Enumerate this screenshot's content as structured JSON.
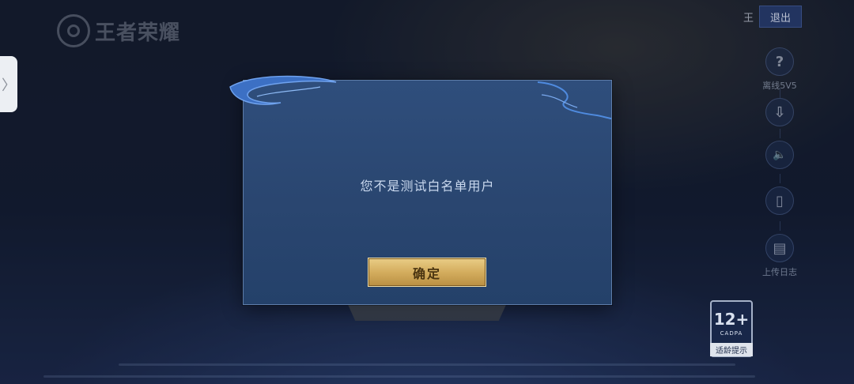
{
  "app": {
    "logo_text": "王者荣耀"
  },
  "side_tab": {
    "icon": "chevron-right-icon",
    "glyph": "〉"
  },
  "header": {
    "user_name": "王",
    "logout_label": "退出"
  },
  "right_menu": [
    {
      "id": "offline",
      "icon": "question-icon",
      "glyph": "?",
      "label": "离线5V5"
    },
    {
      "id": "download",
      "icon": "download-icon",
      "glyph": "⇩",
      "label": ""
    },
    {
      "id": "sound",
      "icon": "speaker-icon",
      "glyph": "🔈",
      "label": ""
    },
    {
      "id": "repair",
      "icon": "phone-repair-icon",
      "glyph": "▯",
      "label": ""
    },
    {
      "id": "upload-log",
      "icon": "clipboard-icon",
      "glyph": "▤",
      "label": "上传日志"
    }
  ],
  "age_rating": {
    "rating": "12+",
    "org": "CADPA",
    "hint": "适龄提示"
  },
  "dialog": {
    "message": "您不是测试白名单用户",
    "confirm_label": "确定"
  },
  "colors": {
    "dialog_bg": "#2b4872",
    "dialog_border": "#5f7eaa",
    "confirm_gold": "#d4ad5e",
    "message_text": "#c9d8ee"
  }
}
